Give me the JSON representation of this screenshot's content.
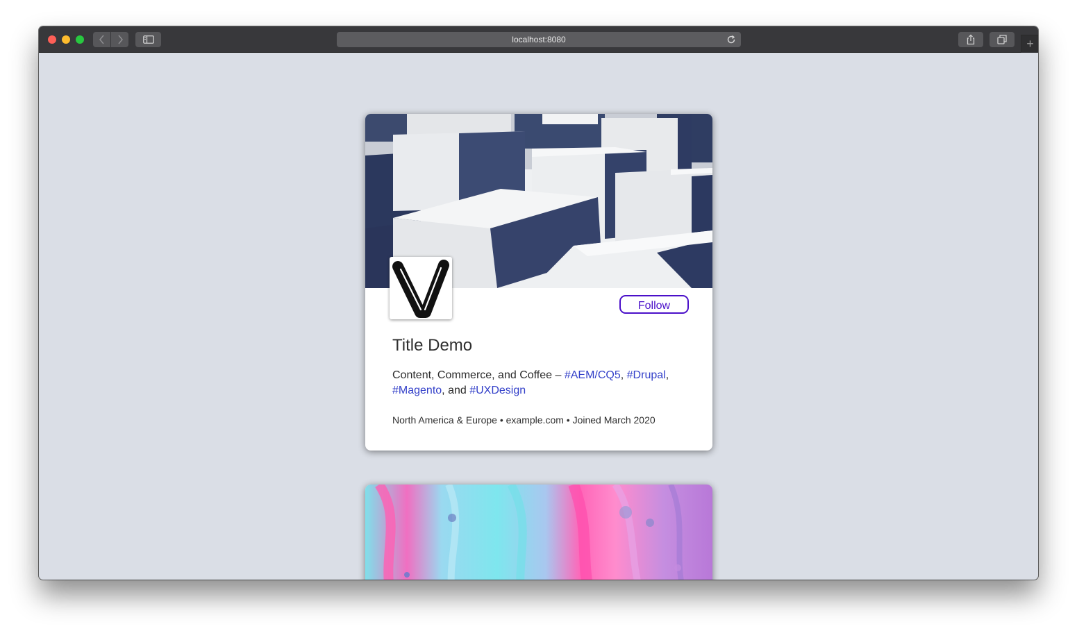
{
  "browser": {
    "url": "localhost:8080"
  },
  "profile_card": {
    "follow_label": "Follow",
    "title": "Title Demo",
    "bio": {
      "text_1": "Content, Commerce, and Coffee – ",
      "tag_1": "#AEM/CQ5",
      "sep_1": ", ",
      "tag_2": "#Drupal",
      "sep_2": ", ",
      "tag_3": "#Magento",
      "sep_3": ", and ",
      "tag_4": "#UXDesign"
    },
    "meta": "North America & Europe • example.com • Joined March 2020",
    "colors": {
      "follow_accent": "#4a0fc9",
      "hashtag_link": "#3340c9",
      "page_background": "#dadee6"
    }
  },
  "icons": {
    "avatar_logo": "v-logo-icon",
    "reload": "reload-icon",
    "back": "chevron-left-icon",
    "forward": "chevron-right-icon",
    "sidebar": "sidebar-icon",
    "share": "share-icon",
    "tabs": "tabs-icon",
    "new_tab": "plus-icon"
  }
}
